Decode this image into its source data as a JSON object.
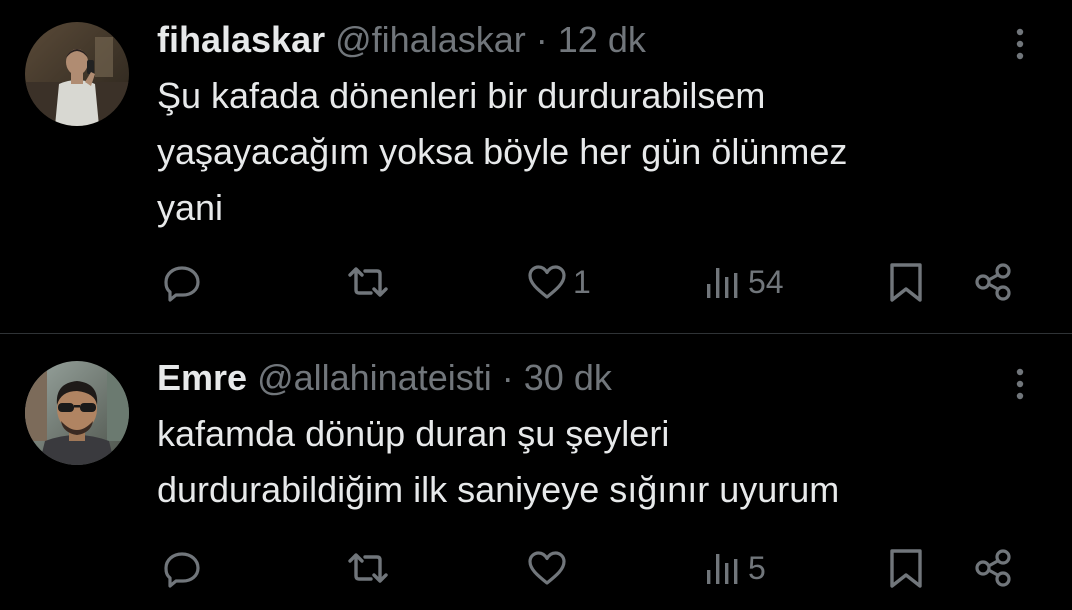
{
  "colors": {
    "background": "#000000",
    "text": "#e7e9ea",
    "secondary": "#71767b",
    "divider": "#2f3336"
  },
  "tweets": [
    {
      "display_name": "fihalaskar",
      "handle": "@fihalaskar",
      "separator": "·",
      "time": "12 dk",
      "text_lines": [
        "Şu kafada dönenleri bir durdurabilsem",
        "yaşayacağım yoksa böyle her gün ölünmez",
        "yani"
      ],
      "likes": "1",
      "views": "54"
    },
    {
      "display_name": "Emre",
      "handle": "@allahinateisti",
      "separator": "·",
      "time": "30 dk",
      "text_lines": [
        "kafamda dönüp duran şu şeyleri",
        "durdurabildiğim ilk saniyeye sığınır uyurum"
      ],
      "likes": "",
      "views": "5"
    }
  ],
  "icons": {
    "reply": "reply-icon",
    "retweet": "retweet-icon",
    "like": "heart-icon",
    "views": "views-chart-icon",
    "bookmark": "bookmark-icon",
    "share": "share-icon",
    "more": "more-vertical-icon"
  }
}
